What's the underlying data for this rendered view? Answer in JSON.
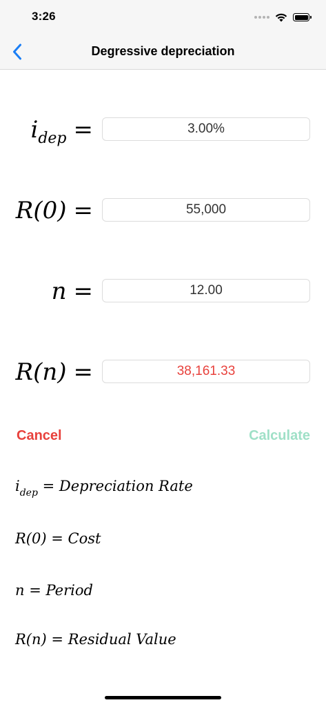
{
  "status_bar": {
    "time": "3:26",
    "icons": [
      "signal-icon",
      "wifi-icon",
      "battery-icon"
    ]
  },
  "nav": {
    "back_icon": "chevron-left-icon",
    "title": "Degressive depreciation"
  },
  "rows": [
    {
      "lhs_var": "i",
      "lhs_sub": "dep",
      "lhs_eq": "=",
      "value": "3.00%"
    },
    {
      "lhs_var": "R(0)",
      "lhs_sub": "",
      "lhs_eq": "=",
      "value": "55,000"
    },
    {
      "lhs_var": "n",
      "lhs_sub": "",
      "lhs_eq": "=",
      "value": "12.00"
    },
    {
      "lhs_var": "R(n)",
      "lhs_sub": "",
      "lhs_eq": "=",
      "value": "38,161.33"
    }
  ],
  "buttons": {
    "cancel": "Cancel",
    "calculate": "Calculate"
  },
  "legend": [
    {
      "var": "i",
      "sub": "dep",
      "eq": " = ",
      "text": "Depreciation Rate"
    },
    {
      "var": "R(0)",
      "sub": "",
      "eq": " = ",
      "text": "Cost"
    },
    {
      "var": "n",
      "sub": "",
      "eq": " = ",
      "text": "Period"
    },
    {
      "var": "R(n)",
      "sub": "",
      "eq": " = ",
      "text": "Residual Value"
    }
  ],
  "colors": {
    "accent_blue": "#1a7ef5",
    "cancel_red": "#e8413c",
    "result_red": "#e8413c",
    "calculate_green": "#9fe0c7"
  }
}
